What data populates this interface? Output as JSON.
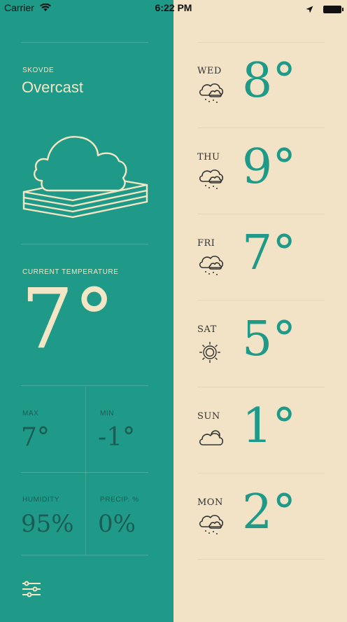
{
  "status_bar": {
    "carrier": "Carrier",
    "time": "6:22 PM"
  },
  "current": {
    "city": "SKOVDE",
    "condition": "Overcast",
    "temp_label": "CURRENT TEMPERATURE",
    "temp": "7°",
    "max_label": "MAX",
    "max": "7°",
    "min_label": "MIN",
    "min": "-1°",
    "humidity_label": "HUMIDITY",
    "humidity": "95%",
    "precip_label": "PRECIP. %",
    "precip": "0%"
  },
  "forecast": [
    {
      "day": "WED",
      "temp": "8°",
      "icon": "rain-cloud-icon"
    },
    {
      "day": "THU",
      "temp": "9°",
      "icon": "rain-cloud-icon"
    },
    {
      "day": "FRI",
      "temp": "7°",
      "icon": "rain-cloud-icon"
    },
    {
      "day": "SAT",
      "temp": "5°",
      "icon": "sun-icon"
    },
    {
      "day": "SUN",
      "temp": "1°",
      "icon": "partly-cloudy-icon"
    },
    {
      "day": "MON",
      "temp": "2°",
      "icon": "rain-cloud-icon"
    }
  ],
  "colors": {
    "teal": "#1f9a88",
    "cream": "#f2e3c6",
    "dark_teal": "#1b5c55"
  }
}
